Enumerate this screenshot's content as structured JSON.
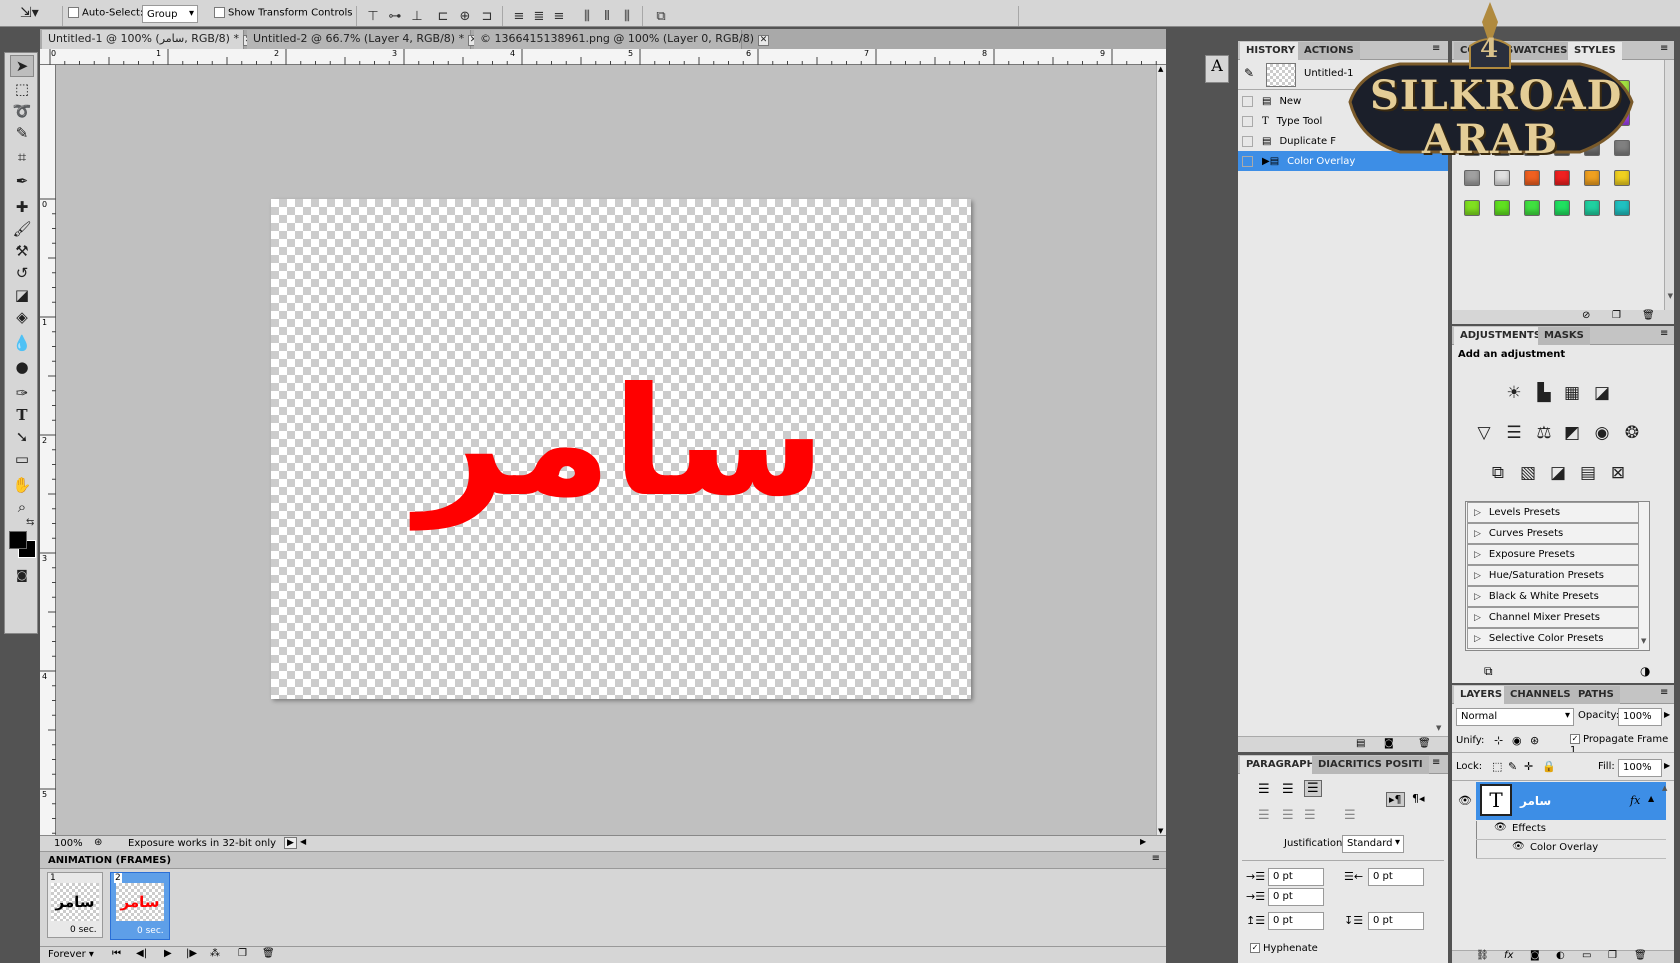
{
  "options_bar": {
    "auto_select_label": "Auto-Select:",
    "auto_select_value": "Group",
    "show_transform_label": "Show Transform Controls"
  },
  "doc_tabs": [
    {
      "label": "Untitled-1 @ 100% (سامر, RGB/8) *"
    },
    {
      "label": "Untitled-2 @ 66.7% (Layer 4, RGB/8) *"
    },
    {
      "label": "© 1366415138961.png @ 100% (Layer 0, RGB/8)"
    }
  ],
  "ruler_h": [
    "0",
    "1",
    "2",
    "3",
    "4",
    "5",
    "6",
    "7",
    "8",
    "9"
  ],
  "ruler_v": [
    "0",
    "1",
    "2",
    "3",
    "4",
    "5"
  ],
  "canvas": {
    "text": "سامر",
    "text_color": "#ff0000"
  },
  "status": {
    "zoom": "100%",
    "message": "Exposure works in 32-bit only"
  },
  "animation": {
    "title": "ANIMATION (FRAMES)",
    "frames": [
      {
        "num": "1",
        "thumb_text": "سامر",
        "delay": "0 sec."
      },
      {
        "num": "2",
        "thumb_text": "سامر",
        "delay": "0 sec."
      }
    ],
    "loop": "Forever"
  },
  "history": {
    "tabs": [
      "HISTORY",
      "ACTIONS"
    ],
    "snapshot": "Untitled-1",
    "items": [
      "New",
      "Type Tool",
      "Duplicate F",
      "Color Overlay"
    ]
  },
  "styles_tabs": [
    "COLOR",
    "SWATCHES",
    "STYLES"
  ],
  "logo": {
    "top": "4",
    "line1": "SILKROAD",
    "line2": "ARAB"
  },
  "adjustments": {
    "tabs": [
      "ADJUSTMENTS",
      "MASKS"
    ],
    "heading": "Add an adjustment",
    "presets": [
      "Levels Presets",
      "Curves Presets",
      "Exposure Presets",
      "Hue/Saturation Presets",
      "Black & White Presets",
      "Channel Mixer Presets",
      "Selective Color Presets"
    ]
  },
  "layers": {
    "tabs": [
      "LAYERS",
      "CHANNELS",
      "PATHS"
    ],
    "blend_mode": "Normal",
    "opacity_label": "Opacity:",
    "opacity": "100%",
    "unify_label": "Unify:",
    "propagate_label": "Propagate Frame 1",
    "lock_label": "Lock:",
    "fill_label": "Fill:",
    "fill": "100%",
    "layer_name": "سامر",
    "effects_label": "Effects",
    "effect_item": "Color Overlay"
  },
  "paragraph": {
    "tabs": [
      "PARAGRAPH",
      "DIACRITICS POSITI"
    ],
    "justification_label": "Justification:",
    "justification_value": "Standard",
    "fields": [
      "0 pt",
      "0 pt",
      "0 pt",
      "0 pt",
      "0 pt"
    ],
    "hyphenate_label": "Hyphenate"
  }
}
